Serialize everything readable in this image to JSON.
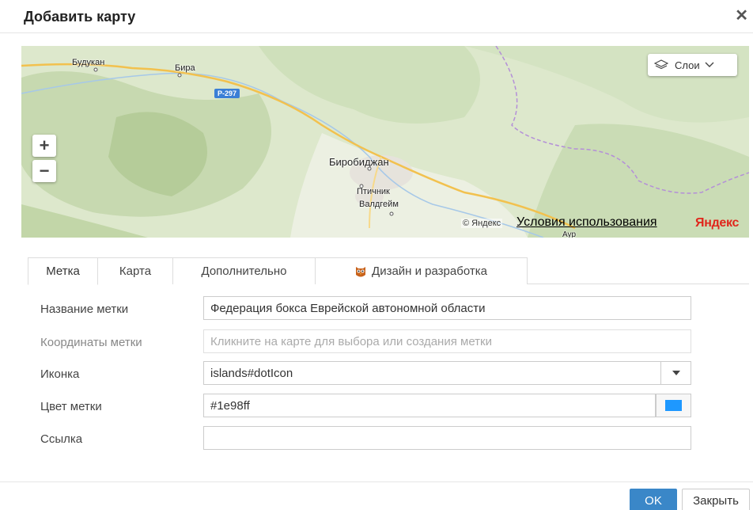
{
  "dialog": {
    "title": "Добавить карту",
    "close_icon": "close-icon"
  },
  "map": {
    "layers_label": "Слои",
    "zoom_in": "+",
    "zoom_out": "−",
    "places": [
      "Будукан",
      "Бира",
      "Биробиджан",
      "Птичник",
      "Валдгейм",
      "Аур"
    ],
    "road_badge": "Р-297",
    "copyright": "© Яндекс",
    "terms_link": "Условия использования",
    "logo": "Яндекс"
  },
  "tabs": [
    {
      "label": "Метка",
      "active": true
    },
    {
      "label": "Карта",
      "active": false
    },
    {
      "label": "Дополнительно",
      "active": false
    },
    {
      "label": "Дизайн и разработка",
      "active": false,
      "icon": "owl-icon"
    }
  ],
  "form": {
    "name_label": "Название метки",
    "name_value": "Федерация бокса Еврейской автономной области",
    "coords_label": "Координаты метки",
    "coords_placeholder": "Кликните на карте для выбора или создания метки",
    "icon_label": "Иконка",
    "icon_value": "islands#dotIcon",
    "color_label": "Цвет метки",
    "color_value": "#1e98ff",
    "link_label": "Ссылка",
    "link_value": ""
  },
  "buttons": {
    "ok": "OK",
    "close": "Закрыть"
  },
  "colors": {
    "primary_button": "#3a87c8",
    "marker_color": "#1e98ff",
    "yandex_red": "#e0261c"
  }
}
